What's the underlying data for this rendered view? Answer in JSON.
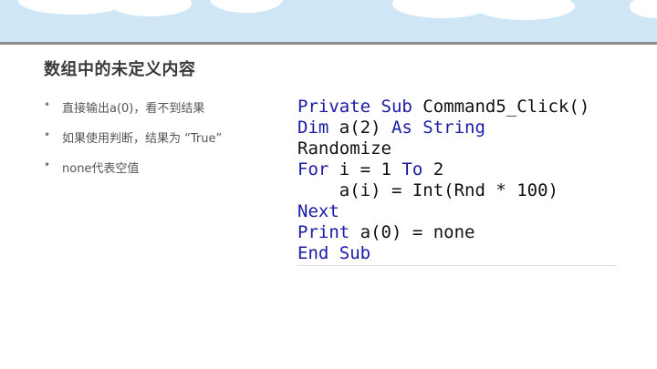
{
  "slide": {
    "title": "数组中的未定义内容",
    "bullet_marker": "•",
    "bullets": [
      "直接输出a(0)，看不到结果",
      "如果使用判断，结果为 “True”",
      "none代表空值"
    ]
  },
  "code": {
    "keyword_color": "#1a1aa8",
    "lines": [
      [
        {
          "t": "Private Sub ",
          "k": true
        },
        {
          "t": "Command5_Click()",
          "k": false
        }
      ],
      [
        {
          "t": "Dim ",
          "k": true
        },
        {
          "t": "a(2) ",
          "k": false
        },
        {
          "t": "As String",
          "k": true
        }
      ],
      [
        {
          "t": "Randomize",
          "k": false
        }
      ],
      [
        {
          "t": "For ",
          "k": true
        },
        {
          "t": "i = 1 ",
          "k": false
        },
        {
          "t": "To ",
          "k": true
        },
        {
          "t": "2",
          "k": false
        }
      ],
      [
        {
          "t": "    a(i) = Int(Rnd * 100)",
          "k": false
        }
      ],
      [
        {
          "t": "Next",
          "k": true
        }
      ],
      [
        {
          "t": "Print ",
          "k": true
        },
        {
          "t": "a(0) = none",
          "k": false
        }
      ],
      [
        {
          "t": "End Sub",
          "k": true
        }
      ]
    ]
  }
}
